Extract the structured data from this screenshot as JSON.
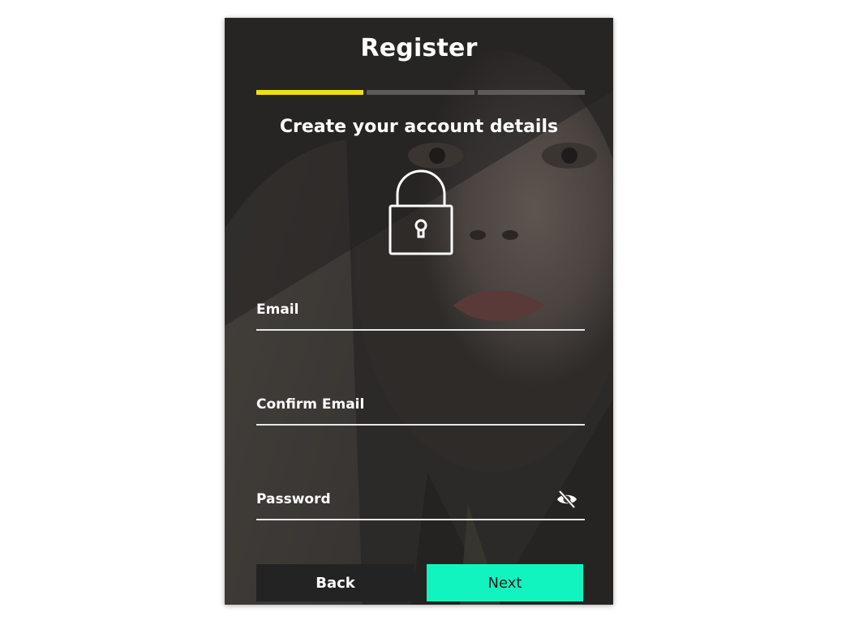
{
  "header": {
    "title": "Register"
  },
  "progress": {
    "steps_total": 3,
    "current_step": 1,
    "active_color": "#f2df10",
    "inactive_color": "#5d5a57"
  },
  "main": {
    "subtitle": "Create your account details",
    "icon": "lock-icon"
  },
  "form": {
    "email": {
      "label": "Email",
      "value": ""
    },
    "confirm_email": {
      "label": "Confirm Email",
      "value": ""
    },
    "password": {
      "label": "Password",
      "value": "",
      "toggle_icon": "eye-slash-icon"
    }
  },
  "buttons": {
    "back_label": "Back",
    "next_label": "Next",
    "next_color": "#12f4c0"
  }
}
